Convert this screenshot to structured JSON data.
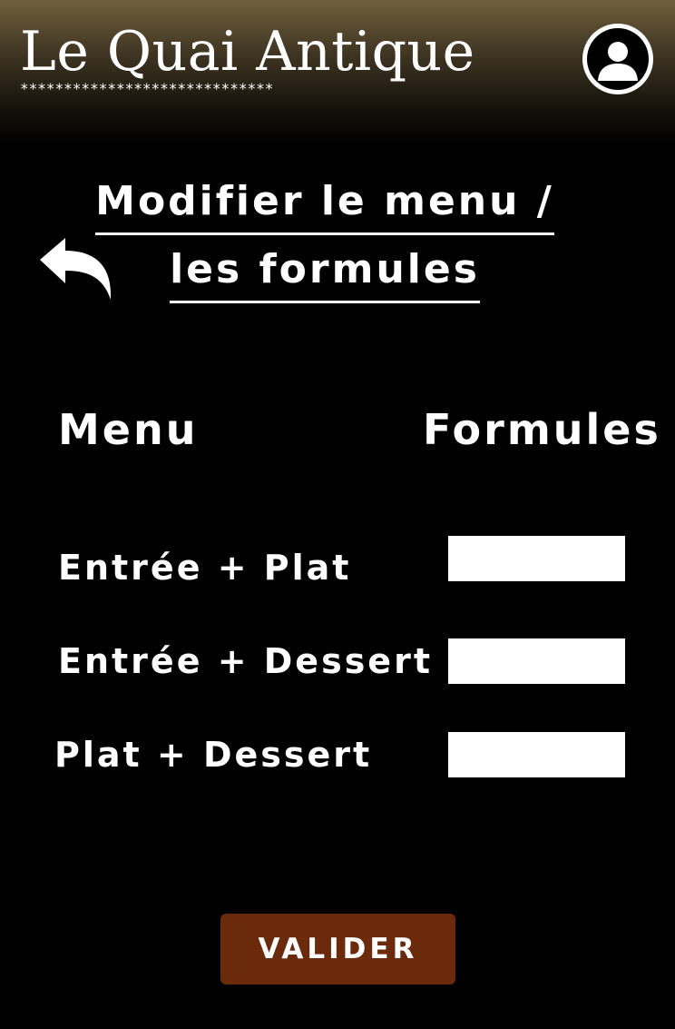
{
  "header": {
    "brand": "Le Quai Antique",
    "stars": "*****************************",
    "account_icon": "user-avatar-icon"
  },
  "nav": {
    "back_icon": "back-arrow-icon"
  },
  "page": {
    "title_line1": "Modifier le menu /",
    "title_line2": "les formules"
  },
  "columns": {
    "menu": "Menu",
    "formules": "Formules"
  },
  "rows": [
    {
      "label": "Entrée + Plat",
      "value": ""
    },
    {
      "label": "Entrée + Dessert",
      "value": ""
    },
    {
      "label": "Plat + Dessert",
      "value": ""
    }
  ],
  "actions": {
    "submit_label": "VALIDER",
    "submit_color": "#6c2a0c"
  }
}
